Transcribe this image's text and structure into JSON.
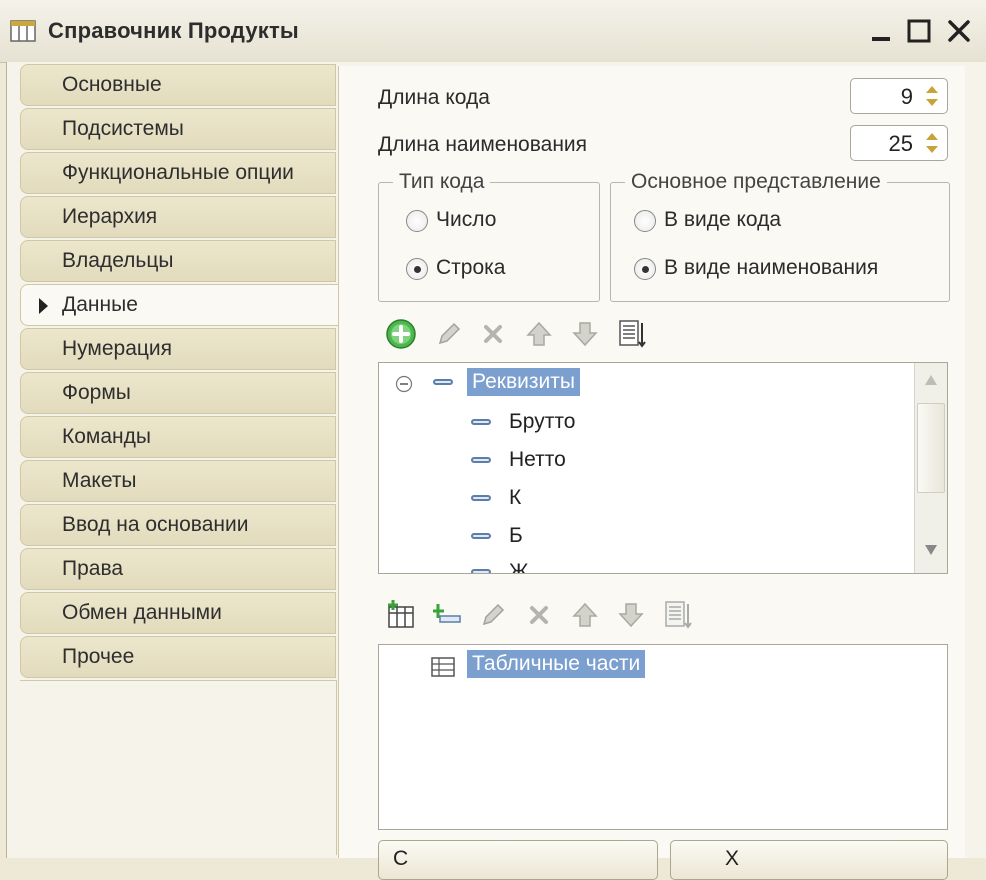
{
  "window": {
    "title": "Справочник Продукты"
  },
  "nav": {
    "items": [
      {
        "label": "Основные"
      },
      {
        "label": "Подсистемы"
      },
      {
        "label": "Функциональные опции"
      },
      {
        "label": "Иерархия"
      },
      {
        "label": "Владельцы"
      },
      {
        "label": "Данные"
      },
      {
        "label": "Нумерация"
      },
      {
        "label": "Формы"
      },
      {
        "label": "Команды"
      },
      {
        "label": "Макеты"
      },
      {
        "label": "Ввод на основании"
      },
      {
        "label": "Права"
      },
      {
        "label": "Обмен данными"
      },
      {
        "label": "Прочее"
      }
    ],
    "active": "Данные"
  },
  "fields": {
    "code_length_label": "Длина кода",
    "code_length_value": "9",
    "name_length_label": "Длина наименования",
    "name_length_value": "25"
  },
  "code_type": {
    "legend": "Тип кода",
    "options": [
      "Число",
      "Строка"
    ],
    "selected": "Строка"
  },
  "main_presentation": {
    "legend": "Основное представление",
    "options": [
      "В виде кода",
      "В виде наименования"
    ],
    "selected": "В виде наименования"
  },
  "attributes_tree": {
    "root": "Реквизиты",
    "items": [
      "Брутто",
      "Нетто",
      "К",
      "Б",
      "Ж"
    ]
  },
  "tabular_tree": {
    "root": "Табличные части"
  },
  "bottom_buttons": [
    "С",
    "Х"
  ],
  "colors": {
    "accent_selection": "#7b9fce",
    "nav_tab_bg": "#e6dfc3",
    "content_bg": "#faf9f3",
    "add_green": "#3aa33a"
  }
}
